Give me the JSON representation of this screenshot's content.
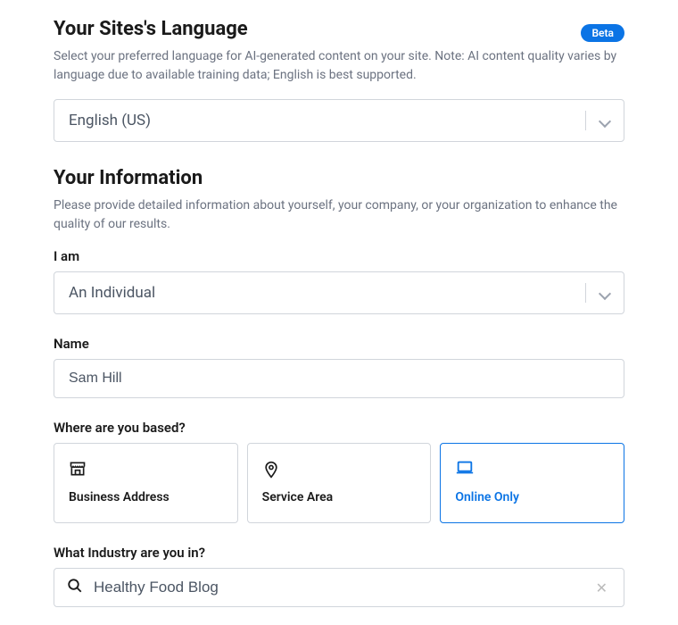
{
  "language_section": {
    "title": "Your Sites's Language",
    "badge": "Beta",
    "description": "Select your preferred language for AI-generated content on your site. Note: AI content quality varies by language due to available training data; English is best supported.",
    "selected": "English (US)"
  },
  "info_section": {
    "title": "Your Information",
    "description": "Please provide detailed information about yourself, your company, or your organization to enhance the quality of our results."
  },
  "iam_field": {
    "label": "I am",
    "selected": "An Individual"
  },
  "name_field": {
    "label": "Name",
    "value": "Sam Hill"
  },
  "based_field": {
    "label": "Where are you based?",
    "options": {
      "business": "Business Address",
      "service": "Service Area",
      "online": "Online Only"
    },
    "selected": "online"
  },
  "industry_field": {
    "label": "What Industry are you in?",
    "value": "Healthy Food Blog"
  }
}
